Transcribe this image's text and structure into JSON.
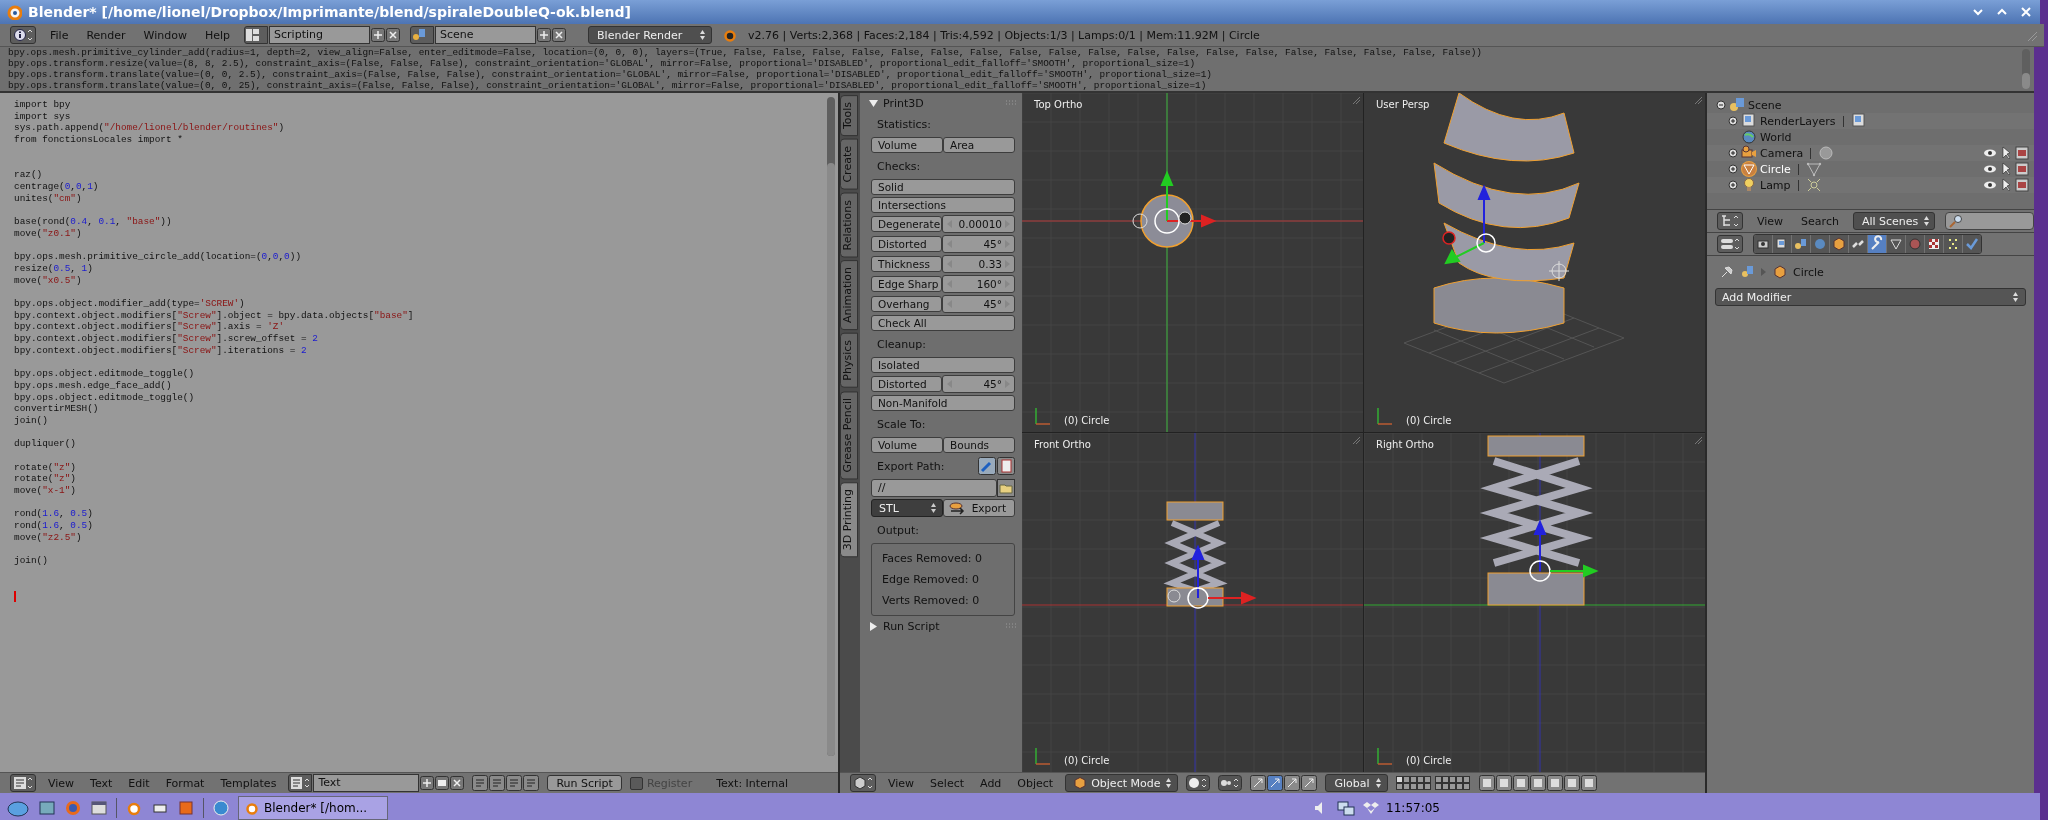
{
  "window": {
    "title": "Blender* [/home/lionel/Dropbox/Imprimante/blend/spiraleDoubleQ-ok.blend]"
  },
  "header": {
    "menus": [
      "File",
      "Render",
      "Window",
      "Help"
    ],
    "layout": "Scripting",
    "scene": "Scene",
    "engine": "Blender Render",
    "stats": "v2.76 | Verts:2,368 | Faces:2,184 | Tris:4,592 | Objects:1/3 | Lamps:0/1 | Mem:11.92M | Circle"
  },
  "console": {
    "lines": [
      "bpy.ops.mesh.primitive_cylinder_add(radius=1, depth=2, view_align=False, enter_editmode=False, location=(0, 0, 0), layers=(True, False, False, False, False, False, False, False, False, False, False, False, False, False, False, False, False, False, False, False))",
      "bpy.ops.transform.resize(value=(8, 8, 2.5), constraint_axis=(False, False, False), constraint_orientation='GLOBAL', mirror=False, proportional='DISABLED', proportional_edit_falloff='SMOOTH', proportional_size=1)",
      "bpy.ops.transform.translate(value=(0, 0, 2.5), constraint_axis=(False, False, False), constraint_orientation='GLOBAL', mirror=False, proportional='DISABLED', proportional_edit_falloff='SMOOTH', proportional_size=1)",
      "bpy.ops.transform.translate(value=(0, 0, 25), constraint_axis=(False, False, False), constraint_orientation='GLOBAL', mirror=False, proportional='DISABLED', proportional_edit_falloff='SMOOTH', proportional_size=1)"
    ]
  },
  "text_editor": {
    "code_blocks": [
      [
        "import bpy",
        "import sys",
        "sys.path.append(\"/home/lionel/blender/routines\")",
        "from fonctionsLocales import *"
      ],
      [
        "raz()",
        "centrage(0,0,1)",
        "unites(\"cm\")"
      ],
      [
        "base(rond(0.4, 0.1, \"base\"))",
        "move(\"z0.1\")"
      ],
      [
        "bpy.ops.mesh.primitive_circle_add(location=(0,0,0))",
        "resize(0.5, 1)",
        "move(\"x0.5\")"
      ],
      [
        "bpy.ops.object.modifier_add(type='SCREW')",
        "bpy.context.object.modifiers[\"Screw\"].object = bpy.data.objects[\"base\"]",
        "bpy.context.object.modifiers[\"Screw\"].axis = 'Z'",
        "bpy.context.object.modifiers[\"Screw\"].screw_offset = 2",
        "bpy.context.object.modifiers[\"Screw\"].iterations = 2"
      ],
      [
        "bpy.ops.object.editmode_toggle()",
        "bpy.ops.mesh.edge_face_add()",
        "bpy.ops.object.editmode_toggle()",
        "convertirMESH()",
        "join()"
      ],
      [
        "dupliquer()"
      ],
      [
        "rotate(\"z\")",
        "rotate(\"z\")",
        "move(\"x-1\")"
      ],
      [
        "rond(1.6, 0.5)",
        "rond(1.6, 0.5)",
        "move(\"z2.5\")"
      ],
      [
        "join()"
      ]
    ],
    "header": {
      "menus": [
        "View",
        "Text",
        "Edit",
        "Format",
        "Templates"
      ],
      "datablock": "Text",
      "run_button": "Run Script",
      "register": {
        "label": "Register",
        "checked": false
      },
      "source": "Text: Internal"
    }
  },
  "tool_shelf": {
    "tabs": [
      {
        "label": "Tools",
        "selected": false
      },
      {
        "label": "Create",
        "selected": false
      },
      {
        "label": "Relations",
        "selected": false
      },
      {
        "label": "Animation",
        "selected": false
      },
      {
        "label": "Physics",
        "selected": false
      },
      {
        "label": "Grease Pencil",
        "selected": false
      },
      {
        "label": "3D Printing",
        "selected": true
      }
    ],
    "panels": [
      {
        "title": "Print3D",
        "expanded": true,
        "rows": [
          {
            "kind": "heading",
            "text": "Statistics:"
          },
          {
            "kind": "buttons",
            "items": [
              "Volume",
              "Area"
            ]
          },
          {
            "kind": "heading",
            "text": "Checks:"
          },
          {
            "kind": "buttons",
            "items": [
              "Solid"
            ]
          },
          {
            "kind": "buttons",
            "items": [
              "Intersections"
            ]
          },
          {
            "kind": "number",
            "label": "Degenerate",
            "value": "0.00010"
          },
          {
            "kind": "number",
            "label": "Distorted",
            "value": "45°"
          },
          {
            "kind": "number",
            "label": "Thickness",
            "value": "0.33"
          },
          {
            "kind": "number",
            "label": "Edge Sharp",
            "value": "160°"
          },
          {
            "kind": "number",
            "label": "Overhang",
            "value": "45°"
          },
          {
            "kind": "buttons",
            "items": [
              "Check All"
            ]
          },
          {
            "kind": "heading",
            "text": "Cleanup:"
          },
          {
            "kind": "buttons",
            "items": [
              "Isolated"
            ]
          },
          {
            "kind": "number",
            "label": "Distorted",
            "value": "45°"
          },
          {
            "kind": "buttons",
            "items": [
              "Non-Manifold"
            ]
          },
          {
            "kind": "heading",
            "text": "Scale To:"
          },
          {
            "kind": "buttons",
            "items": [
              "Volume",
              "Bounds"
            ]
          },
          {
            "kind": "path_heading",
            "text": "Export Path:"
          },
          {
            "kind": "path",
            "value": "//"
          },
          {
            "kind": "export",
            "format": "STL",
            "button": "Export"
          },
          {
            "kind": "heading",
            "text": "Output:"
          },
          {
            "kind": "output",
            "lines": [
              "Faces Removed: 0",
              "Edge Removed: 0",
              "Verts Removed: 0"
            ]
          }
        ]
      },
      {
        "title": "Run Script",
        "expanded": false
      }
    ]
  },
  "viewports": [
    {
      "kind": "top",
      "view": "Top Ortho",
      "object_label": "(0) Circle"
    },
    {
      "kind": "persp",
      "view": "User Persp",
      "object_label": "(0) Circle"
    },
    {
      "kind": "front",
      "view": "Front Ortho",
      "object_label": "(0) Circle"
    },
    {
      "kind": "right",
      "view": "Right Ortho",
      "object_label": "(0) Circle"
    }
  ],
  "view3d_header": {
    "menus": [
      "View",
      "Select",
      "Add",
      "Object"
    ],
    "mode": "Object Mode",
    "orientation": "Global"
  },
  "outliner": {
    "items": [
      {
        "name": "Scene",
        "kind": "scene",
        "expanded": true,
        "children": [
          {
            "name": "RenderLayers",
            "kind": "renderlayers",
            "expanded": false
          },
          {
            "name": "World",
            "kind": "world"
          },
          {
            "name": "Camera",
            "kind": "camera",
            "expanded": false,
            "selected": false
          },
          {
            "name": "Circle",
            "kind": "mesh",
            "expanded": false,
            "selected": true
          },
          {
            "name": "Lamp",
            "kind": "lamp",
            "expanded": false,
            "selected": false
          }
        ]
      }
    ],
    "header": {
      "menus": [
        "View",
        "Search"
      ],
      "filter": "All Scenes"
    }
  },
  "properties": {
    "tabs": [
      {
        "kind": "render",
        "selected": false
      },
      {
        "kind": "layers",
        "selected": false
      },
      {
        "kind": "scene",
        "selected": false
      },
      {
        "kind": "world",
        "selected": false
      },
      {
        "kind": "object",
        "selected": false
      },
      {
        "kind": "constraints",
        "selected": false
      },
      {
        "kind": "modifiers",
        "selected": true
      },
      {
        "kind": "data",
        "selected": false
      },
      {
        "kind": "material",
        "selected": false
      },
      {
        "kind": "texture",
        "selected": false
      },
      {
        "kind": "particles",
        "selected": false
      },
      {
        "kind": "physics",
        "selected": false
      }
    ],
    "object": "Circle",
    "add_modifier": "Add Modifier"
  },
  "taskbar": {
    "task": "Blender* [/hom...",
    "clock": "11:57:05"
  }
}
